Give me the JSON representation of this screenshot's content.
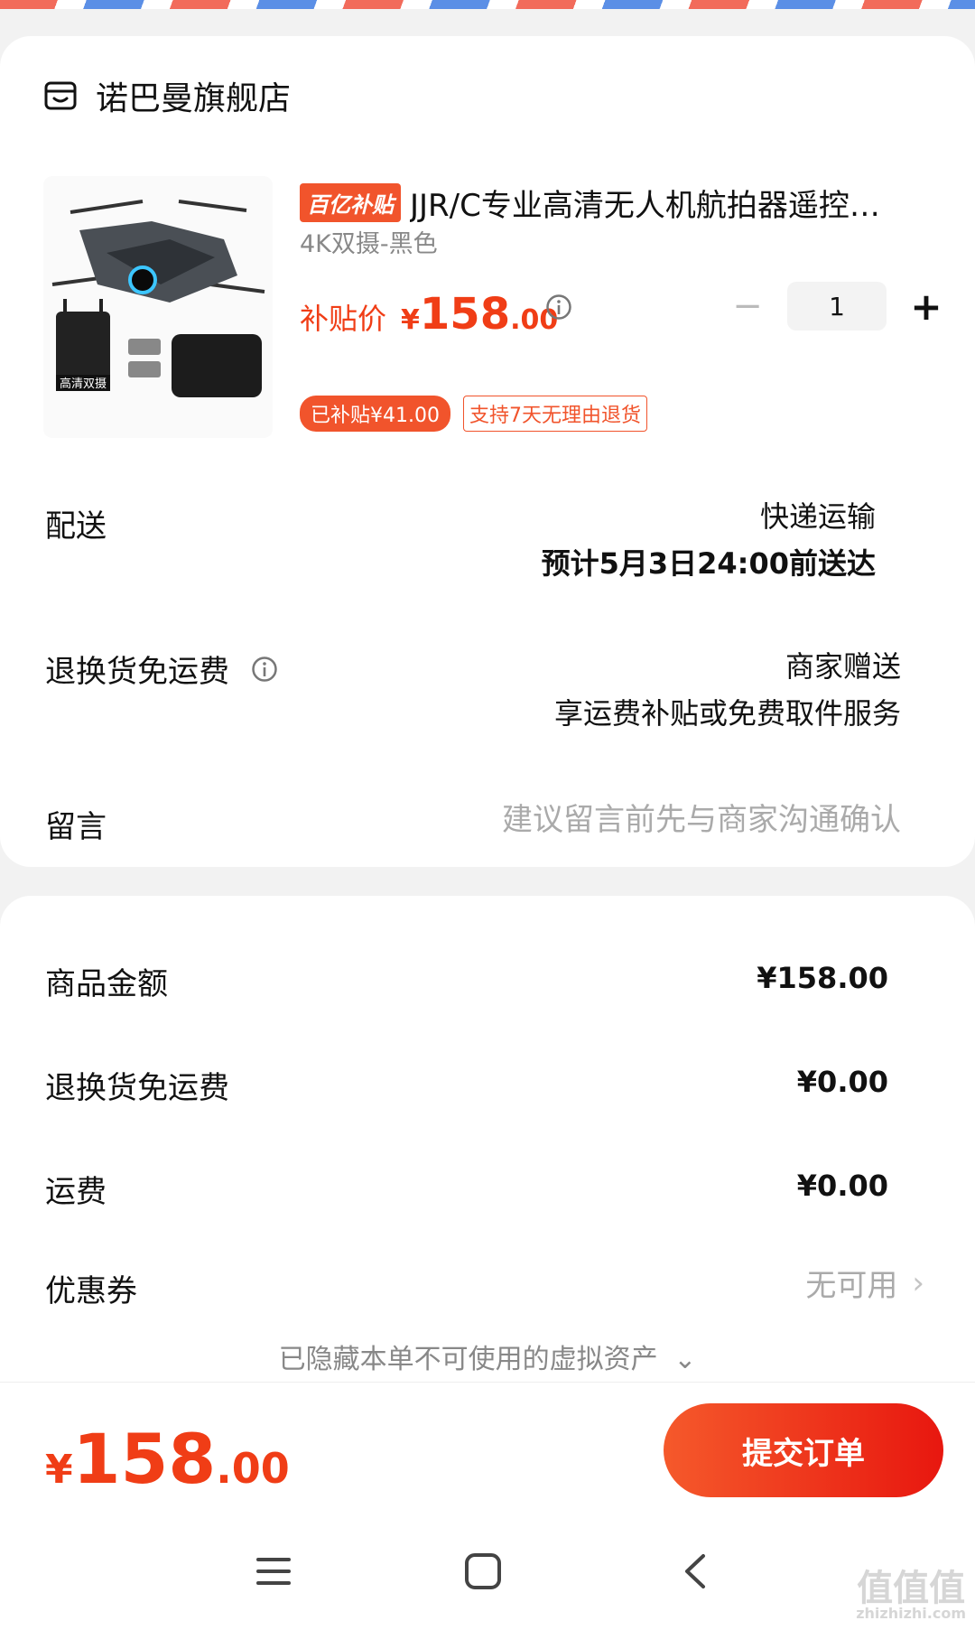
{
  "shop": {
    "name": "诺巴曼旗舰店"
  },
  "product": {
    "badge": "百亿补贴",
    "title": "JJR/C专业高清无人机航拍器遥控…",
    "variant": "4K双摄-黑色",
    "price_label": "补贴价",
    "price_yen": "¥",
    "price_int": "158",
    "price_dec": ".00",
    "quantity": "1",
    "tag_subsidy": "已补贴¥41.00",
    "tag_return": "支持7天无理由退货",
    "thumb_label": "高清双摄"
  },
  "delivery": {
    "label": "配送",
    "method": "快递运输",
    "eta": "预计5月3日24:00前送达"
  },
  "return_shipping": {
    "label": "退换货免运费",
    "value": "商家赠送",
    "desc": "享运费补贴或免费取件服务"
  },
  "message": {
    "label": "留言",
    "placeholder": "建议留言前先与商家沟通确认"
  },
  "summary": {
    "goods_label": "商品金额",
    "goods_value": "¥158.00",
    "return_label": "退换货免运费",
    "return_value": "¥0.00",
    "freight_label": "运费",
    "freight_value": "¥0.00",
    "coupon_label": "优惠券",
    "coupon_value": "无可用",
    "hidden_assets": "已隐藏本单不可使用的虚拟资产"
  },
  "footer": {
    "total_yen": "¥",
    "total_int": "158",
    "total_dec": ".00",
    "submit_label": "提交订单"
  },
  "watermark": {
    "text": "值值值",
    "site": "zhizhizhi.com"
  },
  "colors": {
    "accent": "#f03d16",
    "badge": "#f1542c"
  }
}
